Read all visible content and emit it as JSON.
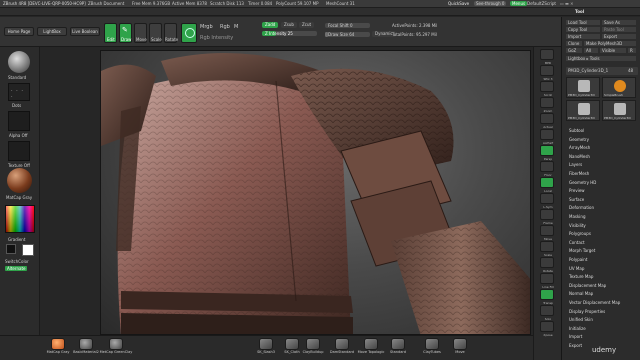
{
  "titlebar": {
    "app": "ZBrush 4R8 [DEVC-LIVE-QRP-0050-HC9P]",
    "document": "ZBrush Document",
    "free_mem": "Free Mem 9.376GB",
    "active_mem": "Active Mem 8378",
    "scratch_disk": "Scratch Disk 113",
    "timer": "Timer 0.084",
    "poly_count": "PolyCount 59.107 MP",
    "mesh_count": "MeshCount 31",
    "quicksave": "QuickSave",
    "see_through": "See-through 0",
    "menus_btn": "Menus",
    "default_script": "DefaultZScript"
  },
  "menubar": {
    "items": [
      "Alpha",
      "Brush",
      "Color",
      "Document",
      "Draw",
      "Edit",
      "File",
      "Layer",
      "Light",
      "Macro",
      "Marker",
      "Material",
      "Movie",
      "Picker",
      "Preferences",
      "Render",
      "Stencil",
      "Stroke",
      "Texture",
      "Tool",
      "Transform",
      "Zplugin",
      "Zscript"
    ]
  },
  "toolbar": {
    "home_page": "Home Page",
    "lightbox": "LightBox",
    "live_boolean": "Live Boolean",
    "edit": "Edit",
    "draw": "Draw",
    "move": "Move",
    "scale": "Scale",
    "rotate": "Rotate",
    "mrgb": "Mrgb",
    "rgb": "Rgb",
    "m": "M",
    "zadd": "Zadd",
    "zsub": "Zsub",
    "zcut": "Zcut",
    "rgb_intensity": "Rgb Intensity",
    "z_intensity": "Z Intensity 25",
    "z_intensity_value": 25,
    "focal_shift": "Focal Shift 0",
    "draw_size": "Draw Size 64",
    "draw_size_value": 64,
    "dynamic": "Dynamic",
    "active_points": "ActivePoints: 2.398 Mil",
    "total_points": "TotalPoints: 95.297 Mil"
  },
  "leftshelf": {
    "brush_label": "Standard",
    "stroke_label": "Dots",
    "alpha_label": "Alpha Off",
    "texture_label": "Texture Off",
    "material_label": "MatCap Gray",
    "gradient_label": "Gradient",
    "switch_color": "SwitchColor",
    "alternate": "Alternate"
  },
  "rightshelf": {
    "items": [
      "BPR",
      "SPix 3",
      "Scroll",
      "Zoom",
      "Actual",
      "AAHalf",
      "Persp",
      "Floor",
      "Local",
      "L.Sym",
      "Frame",
      "Move",
      "Scale",
      "Rotate",
      "Line Fill",
      "Transp",
      "Solo",
      "Xpose"
    ]
  },
  "tray": {
    "header": "Tool",
    "load_tool": "Load Tool",
    "save_as": "Save As",
    "copy_tool": "Copy Tool",
    "paste_tool": "Paste Tool",
    "import": "Import",
    "export": "Export",
    "clone": "Clone",
    "make_polymesh": "Make PolyMesh3D",
    "goz": "GoZ",
    "all": "All",
    "visible": "Visible",
    "r": "R",
    "lightbox_tools": "Lightbox ▸ Tools",
    "current_tool": "PM3D_Cylinder3D_1",
    "current_tool_count": "48",
    "tool_thumbs": [
      "PM3D_Cylinder3D",
      "SimpleBrush",
      "PM3D_Cylinder3D",
      "PM3D_Cylinder3D"
    ],
    "subpalettes": [
      "Subtool",
      "Geometry",
      "ArrayMesh",
      "NanoMesh",
      "Layers",
      "FiberMesh",
      "Geometry HD",
      "Preview",
      "Surface",
      "Deformation",
      "Masking",
      "Visibility",
      "Polygroups",
      "Contact",
      "Morph Target",
      "Polypaint",
      "UV Map",
      "Texture Map",
      "Displacement Map",
      "Normal Map",
      "Vector Displacement Map",
      "Display Properties",
      "Unified Skin",
      "Initialize",
      "Import",
      "Export"
    ]
  },
  "bottomshelf": {
    "brushes": [
      "SK_Slash3",
      "SK_Cloth",
      "ClayBuildup",
      "DamStandard",
      "Move Topologic",
      "Standard",
      "ClayTubes",
      "Move"
    ],
    "materials": [
      "MatCap Gray",
      "BasicMaterial2",
      "MetCap GreenClay"
    ],
    "watermark": "udemy"
  },
  "colors": {
    "accent_green": "#2fa34a",
    "accent_orange": "#e08a1e",
    "bg_dark": "#262626"
  }
}
